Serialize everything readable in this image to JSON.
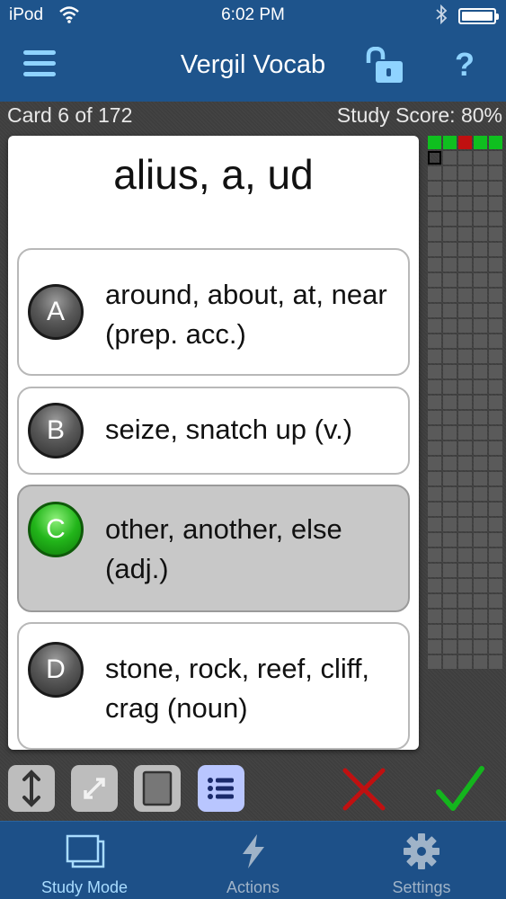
{
  "status": {
    "carrier": "iPod",
    "time": "6:02 PM",
    "icons": [
      "wifi-icon",
      "bluetooth-icon",
      "battery-icon"
    ]
  },
  "nav": {
    "title": "Vergil Vocab",
    "help_label": "?",
    "icons": [
      "menu-icon",
      "unlock-icon",
      "help-icon"
    ]
  },
  "study": {
    "counter": "Card 6 of 172",
    "score": "Study Score: 80%",
    "term": "alius, a, ud",
    "choices": [
      {
        "letter": "A",
        "text": "around, about, at, near (prep. acc.)",
        "selected": false
      },
      {
        "letter": "B",
        "text": "seize, snatch up (v.)",
        "selected": false
      },
      {
        "letter": "C",
        "text": "other, another, else (adj.)",
        "selected": true
      },
      {
        "letter": "D",
        "text": "stone, rock, reef, cliff, crag (noun)",
        "selected": false
      }
    ]
  },
  "progress": {
    "results": [
      "correct",
      "correct",
      "wrong",
      "correct",
      "correct"
    ],
    "current_index": 5,
    "total_cards": 172
  },
  "tools": [
    "flip-vertical-icon",
    "expand-icon",
    "card-view-icon",
    "list-view-icon"
  ],
  "colors": {
    "nav_background": "#1e548c",
    "accent": "#8fd3ff",
    "correct": "#0fbf1f",
    "wrong": "#c01010"
  },
  "tabs": [
    {
      "label": "Study Mode",
      "icon": "study-mode-icon",
      "active": true
    },
    {
      "label": "Actions",
      "icon": "lightning-icon",
      "active": false
    },
    {
      "label": "Settings",
      "icon": "gear-icon",
      "active": false
    }
  ]
}
